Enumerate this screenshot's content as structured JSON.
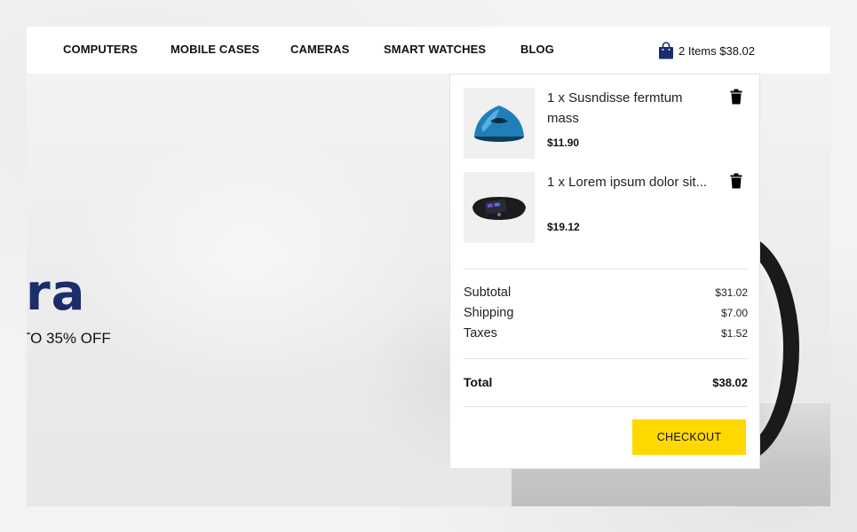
{
  "nav": {
    "items": [
      {
        "label": "COMPUTERS"
      },
      {
        "label": "MOBILE CASES"
      },
      {
        "label": "CAMERAS"
      },
      {
        "label": "SMART WATCHES"
      },
      {
        "label": "BLOG"
      }
    ]
  },
  "cart": {
    "icon": "shopping-bag-icon",
    "summary": "2 Items $38.02",
    "items": [
      {
        "name": "1 x Susndisse fermtum mass",
        "price": "$11.90",
        "thumb_icon": "speaker-icon"
      },
      {
        "name": "1 x Lorem ipsum dolor sit...",
        "price": "$19.12",
        "thumb_icon": "smartwatch-icon"
      }
    ],
    "subtotal_label": "Subtotal",
    "subtotal": "$31.02",
    "shipping_label": "Shipping",
    "shipping": "$7.00",
    "taxes_label": "Taxes",
    "taxes": "$1.52",
    "total_label": "Total",
    "total": "$38.02",
    "checkout_label": "CHECKOUT"
  },
  "hero": {
    "title": "era",
    "subtitle": "TO 35% OFF"
  },
  "colors": {
    "accent": "#ffd800",
    "brand_navy": "#1b2d6b",
    "bag_icon": "#1b2d6b"
  }
}
